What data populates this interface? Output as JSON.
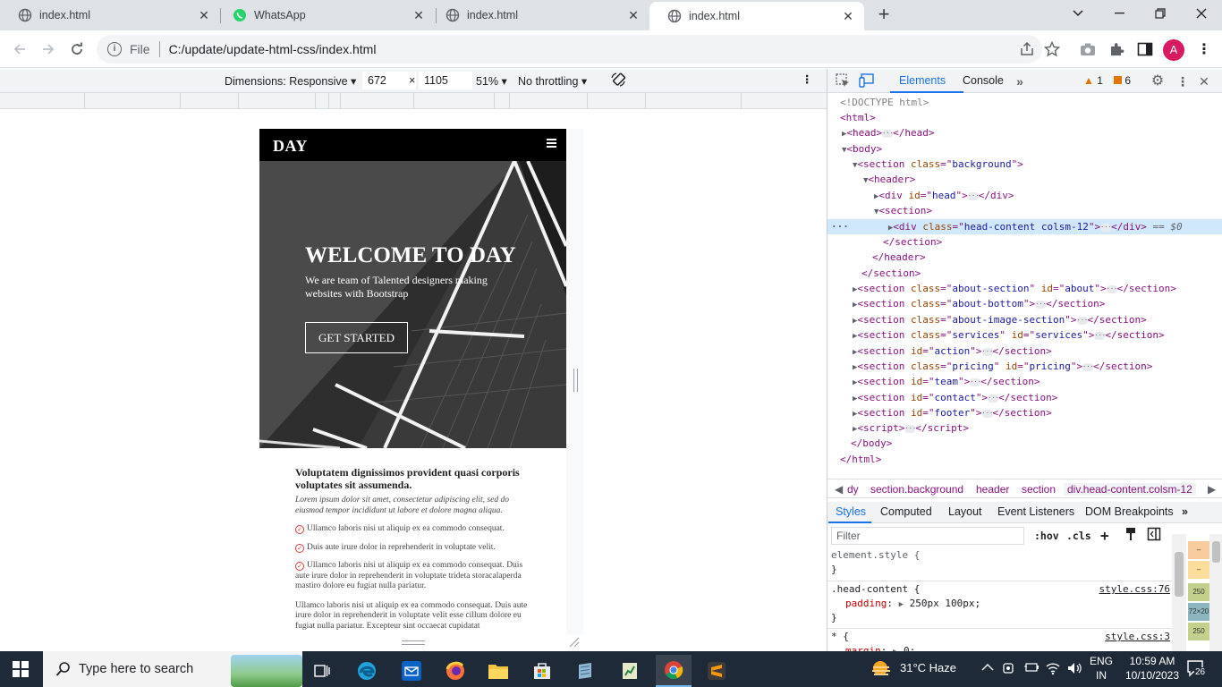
{
  "browser": {
    "tabs": [
      {
        "title": "index.html",
        "icon": "globe-icon"
      },
      {
        "title": "WhatsApp",
        "icon": "whatsapp-icon"
      },
      {
        "title": "index.html",
        "icon": "globe-icon"
      },
      {
        "title": "index.html",
        "icon": "globe-icon",
        "active": true
      }
    ],
    "address": {
      "scheme_label": "File",
      "url": "C:/update/update-html-css/index.html"
    },
    "profile_initial": "A"
  },
  "device_toolbar": {
    "dimensions_label": "Dimensions: Responsive",
    "width": "672",
    "times": "×",
    "height": "1105",
    "zoom": "51%",
    "throttling": "No throttling"
  },
  "site": {
    "logo": "DAY",
    "hero": {
      "title": "WELCOME TO DAY",
      "subtitle": "We are team of Talented designers making websites with Bootstrap",
      "button": "GET STARTED"
    },
    "about": {
      "heading": "Voluptatem dignissimos provident quasi corporis voluptates sit assumenda.",
      "lead": "Lorem ipsum dolor sit amet, consectetur adipiscing elit, sed do eiusmod tempor incididunt ut labore et dolore magna aliqua.",
      "items": [
        "Ullamco laboris nisi ut aliquip ex ea commodo consequat.",
        "Duis aute irure dolor in reprehenderit in voluptate velit.",
        "Ullamco laboris nisi ut aliquip ex ea commodo consequat. Duis aute irure dolor in reprehenderit in voluptate trideta storacalaperda mastiro dolore eu fugiat nulla pariatur."
      ],
      "paragraph": "Ullamco laboris nisi ut aliquip ex ea commodo consequat. Duis aute irure dolor in reprehenderit in voluptate velit esse cillum dolore eu fugiat nulla pariatur. Excepteur sint occaecat cupidatat"
    }
  },
  "devtools": {
    "tabs": {
      "elements": "Elements",
      "console": "Console"
    },
    "warnings": "1",
    "issues": "6",
    "dom": {
      "doctype": "<!DOCTYPE html>",
      "eq_marker": "== $0",
      "sections": [
        {
          "cls": "about-section",
          "id": "about"
        },
        {
          "cls": "about-bottom",
          "id": ""
        },
        {
          "cls": "about-image-section",
          "id": ""
        },
        {
          "cls": "services",
          "id": "services"
        },
        {
          "cls": "",
          "id": "action"
        },
        {
          "cls": "pricing",
          "id": "pricing"
        },
        {
          "cls": "",
          "id": "team"
        },
        {
          "cls": "",
          "id": "contact"
        },
        {
          "cls": "",
          "id": "footer"
        }
      ],
      "head_id": "head",
      "selected_class": "head-content colsm-12",
      "background_class": "background"
    },
    "breadcrumbs": [
      "dy",
      "section.background",
      "header",
      "section",
      "div.head-content.colsm-12"
    ],
    "styles_tabs": [
      "Styles",
      "Computed",
      "Layout",
      "Event Listeners",
      "DOM Breakpoints"
    ],
    "filter_placeholder": "Filter",
    "hov": ":hov",
    "cls": ".cls",
    "rules": {
      "element_style": "element.style {",
      "close": "}",
      "rule1_selector": ".head-content {",
      "rule1_source": "style.css:76",
      "rule1_prop": "padding",
      "rule1_value": "250px 100px;",
      "rule2_selector": "* {",
      "rule2_source": "style.css:3",
      "rule2_prop": "margin",
      "rule2_value": "0;"
    },
    "box_model": [
      "–",
      "–",
      "250",
      "72×20",
      "250"
    ]
  },
  "taskbar": {
    "search_placeholder": "Type here to search",
    "weather": "31°C  Haze",
    "lang_top": "ENG",
    "lang_bottom": "IN",
    "time": "10:59 AM",
    "date": "10/10/2023",
    "notifications": "26"
  },
  "colors": {
    "accent": "#1a73e8",
    "tag": "#881280",
    "attr": "#994500",
    "value": "#1a1aa6",
    "taskbar": "#1f2a38"
  }
}
